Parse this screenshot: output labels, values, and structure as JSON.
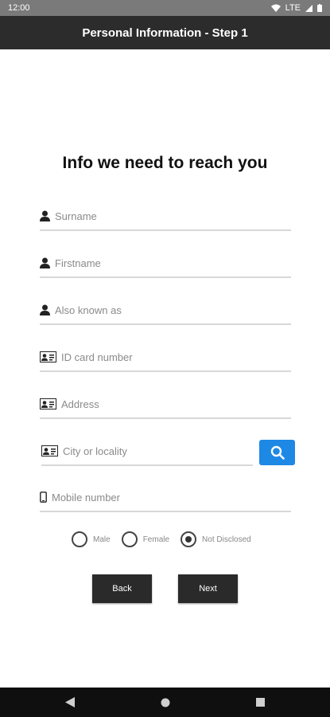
{
  "status_bar": {
    "time": "12:00",
    "network": "LTE"
  },
  "app_bar": {
    "title": "Personal Information - Step 1"
  },
  "heading": "Info we need to reach you",
  "fields": {
    "surname": "Surname",
    "firstname": "Firstname",
    "alias": "Also known as",
    "id_card": "ID card number",
    "address": "Address",
    "city": "City or locality",
    "mobile": "Mobile number"
  },
  "gender": {
    "options": [
      "Male",
      "Female",
      "Not Disclosed"
    ],
    "selected": "Not Disclosed"
  },
  "buttons": {
    "back": "Back",
    "next": "Next"
  },
  "colors": {
    "app_bar": "#2c2c2c",
    "search_button": "#1e88e5",
    "button": "#2a2a2a"
  },
  "icons": {
    "person": "person-icon",
    "id_card": "id-card-icon",
    "phone": "phone-icon",
    "search": "search-icon"
  }
}
